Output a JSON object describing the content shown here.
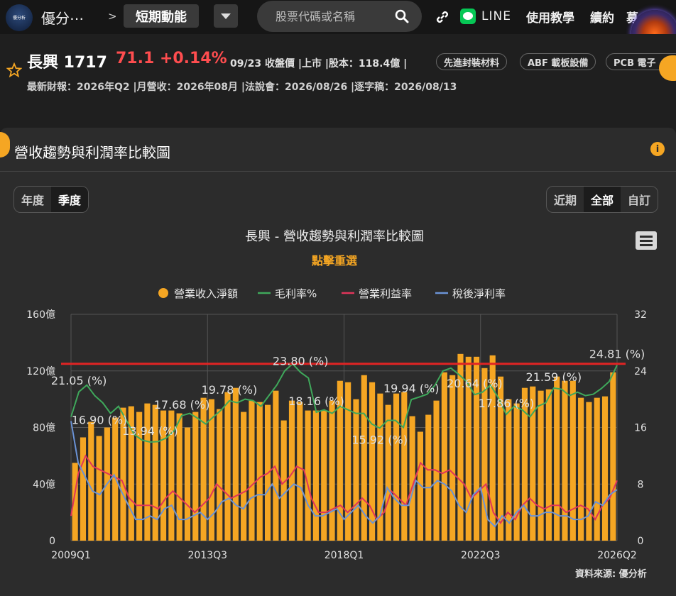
{
  "topbar": {
    "logo_text": "優分析",
    "brand": "優分⋯",
    "crumb_sep": ">",
    "page_label": "短期動能",
    "search_placeholder": "股票代碼或名稱",
    "line_label": "LINE",
    "nav": [
      "使用教學",
      "續約",
      "募"
    ]
  },
  "stock": {
    "name": "長興 1717",
    "price": "71.1 +0.14%",
    "meta": "09/23 收盤價 |上市 |股本：118.4億 |",
    "tags": [
      "先進封裝材料",
      "ABF 載板設備",
      "PCB 電子"
    ],
    "sub": "最新財報：2026年Q2 |月營收：2026年08月 |法說會：2026/08/26 |逐字稿：2026/08/13"
  },
  "card": {
    "title": "營收趨勢與利潤率比較圖",
    "info": "i",
    "period_tabs": [
      "年度",
      "季度"
    ],
    "range_tabs": [
      "近期",
      "全部",
      "自訂"
    ]
  },
  "colors": {
    "revenue": "#f5a623",
    "gross": "#3fa85b",
    "operating": "#e0355a",
    "net": "#6b93d6",
    "refline": "#e02424",
    "subtitle": "#f5a623"
  },
  "chart_data": {
    "type": "bar",
    "title": "長興 - 營收趨勢與利潤率比較圖",
    "subtitle": "點擊重選",
    "x_tick_labels": [
      "2009Q1",
      "2013Q3",
      "2018Q1",
      "2022Q3",
      "2026Q2"
    ],
    "y_left": {
      "ticks": [
        "0",
        "40億",
        "80億",
        "120億",
        "160億"
      ],
      "range": [
        0,
        160
      ]
    },
    "y_right": {
      "ticks": [
        "0",
        "8",
        "16",
        "24",
        "32"
      ],
      "range": [
        0,
        32
      ]
    },
    "legend_placement": "top",
    "grid": true,
    "reference_line": {
      "axis": "right",
      "value": 25
    },
    "series": [
      {
        "name": "營業收入淨額",
        "type": "bar",
        "axis": "left",
        "values": [
          55,
          73,
          84,
          74,
          80,
          87,
          94,
          95,
          91,
          97,
          96,
          92,
          92,
          90,
          80,
          91,
          101,
          100,
          93,
          105,
          108,
          91,
          99,
          98,
          96,
          106,
          85,
          99,
          98,
          92,
          92,
          92,
          99,
          113,
          112,
          100,
          117,
          112,
          104,
          96,
          104,
          105,
          88,
          77,
          89,
          99,
          119,
          117,
          132,
          130,
          130,
          122,
          131,
          116,
          100,
          97,
          108,
          109,
          106,
          107,
          116,
          113,
          113,
          101,
          98,
          101,
          102,
          119
        ]
      },
      {
        "name": "毛利率%",
        "type": "line",
        "axis": "right",
        "values": [
          17.5,
          21.05,
          22,
          20.5,
          19.5,
          18,
          19,
          17,
          15,
          14.2,
          13.94,
          14,
          14.5,
          15.5,
          17.68,
          18,
          17.3,
          16.5,
          17.5,
          18.5,
          19.78,
          19.5,
          20,
          19.8,
          19,
          20.5,
          22,
          24,
          25,
          23.8,
          23,
          18.16,
          18.5,
          18,
          19,
          18.5,
          18,
          18,
          16.5,
          15.92,
          17,
          17,
          16,
          19.94,
          20.3,
          20.7,
          22,
          24,
          24.4,
          23.5,
          22.5,
          20.64,
          21,
          22,
          20.2,
          17.86,
          19,
          18.5,
          17.5,
          19,
          19.5,
          21.59,
          21.4,
          20.5,
          21,
          20.5,
          20.7,
          21.5,
          22.5,
          24.81
        ]
      },
      {
        "name": "營業利益率",
        "type": "line",
        "axis": "right",
        "values": [
          3.5,
          9.5,
          12,
          10.5,
          10,
          9.5,
          9,
          8.5,
          6,
          5,
          5,
          5,
          4.5,
          6,
          7,
          6,
          5,
          4,
          5,
          6,
          8,
          7,
          6,
          6.5,
          7,
          8,
          9,
          9.5,
          10.5,
          8,
          9,
          10.5,
          10,
          6,
          4,
          4,
          4.5,
          5,
          4,
          5,
          6,
          5,
          3,
          4,
          7,
          6,
          5,
          8,
          11,
          10,
          10,
          9.5,
          10,
          9,
          8,
          6,
          7,
          8,
          4,
          2.5,
          4,
          3,
          5,
          6,
          5,
          4.5,
          5,
          5,
          4,
          4.5,
          5,
          4.5,
          3,
          5,
          6,
          8.5
        ]
      },
      {
        "name": "稅後淨利率",
        "type": "line",
        "axis": "right",
        "values": [
          16.9,
          11,
          9,
          7,
          6.5,
          8,
          9.3,
          7,
          5,
          3,
          3,
          3.5,
          3,
          4.5,
          5,
          3,
          3,
          3.5,
          4,
          3,
          4,
          5.5,
          6,
          5,
          4.5,
          6,
          6.5,
          6.5,
          8,
          6,
          7,
          8,
          7.5,
          5,
          3.5,
          3.5,
          4,
          4.5,
          3,
          4,
          5,
          3.5,
          2.5,
          3.5,
          7.5,
          6,
          5,
          5,
          8.5,
          7.5,
          7.5,
          8.5,
          8,
          7,
          5,
          4,
          6.5,
          7.5,
          3,
          2,
          3.5,
          2.5,
          4,
          5,
          3.5,
          3.5,
          4,
          4,
          3.5,
          3.5,
          3,
          3,
          3.5,
          5.5,
          5,
          6.5,
          7.2
        ]
      }
    ]
  },
  "source": "資料來源: 優分析"
}
